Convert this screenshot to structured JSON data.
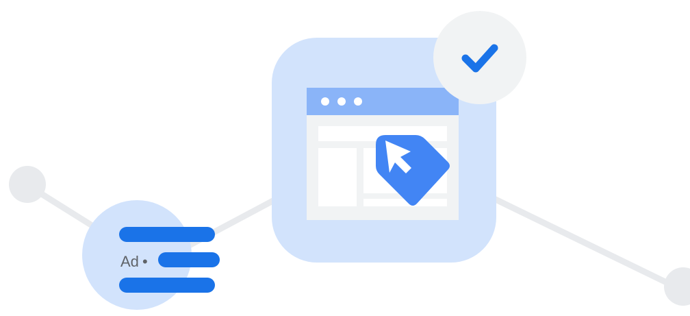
{
  "illustration": {
    "ad_badge": {
      "label": "Ad",
      "separator": "•"
    },
    "browser": {
      "dots": 3,
      "tag_icon": "tag-cursor-icon"
    },
    "verified": {
      "icon": "checkmark-icon"
    },
    "colors": {
      "background": "#ffffff",
      "line": "#e8eaed",
      "node": "#e8eaed",
      "light_blue": "#d2e3fc",
      "mid_blue": "#8ab4f8",
      "brand_blue": "#1a73e8",
      "tag_blue": "#4285f4",
      "panel_grey": "#f1f3f4",
      "text_grey": "#5f6368"
    }
  }
}
